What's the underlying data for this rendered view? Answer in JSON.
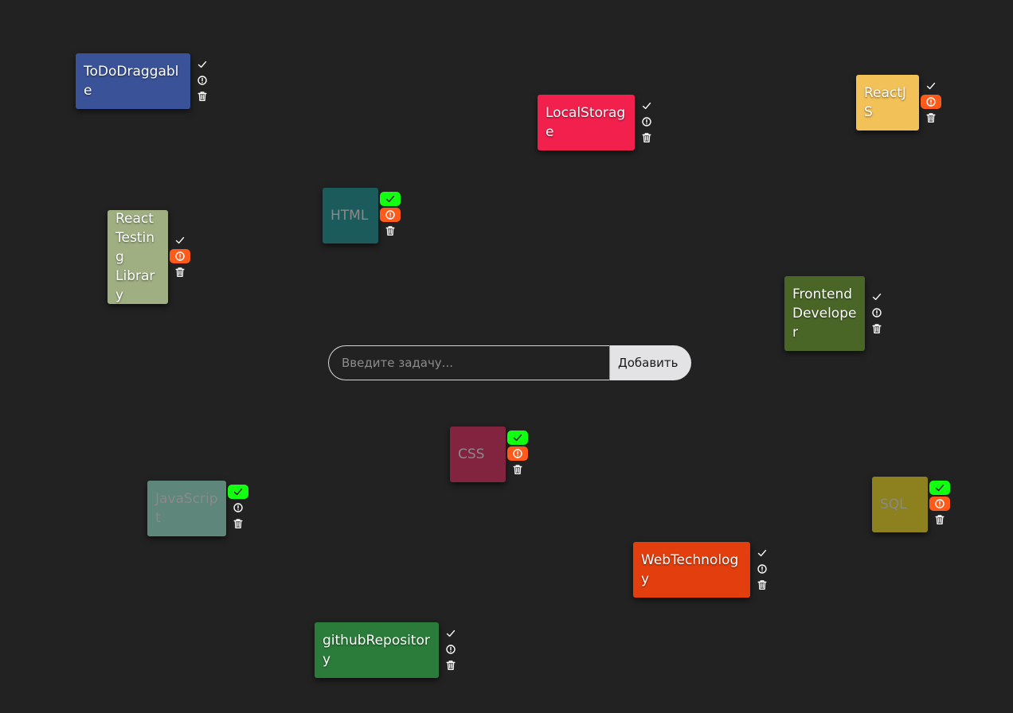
{
  "form": {
    "placeholder": "Введите задачу...",
    "value": "",
    "add_label": "Добавить"
  },
  "colors": {
    "background": "#222222",
    "done_active": "#12ff12",
    "important_active": "#ff5a1a"
  },
  "icons": {
    "done": "check-icon",
    "important": "alert-circle-icon",
    "delete": "trash-icon"
  },
  "tasks": [
    {
      "text": "ToDoDraggable",
      "color": "#3a5297",
      "done": false,
      "important": false
    },
    {
      "text": "LocalStorage",
      "color": "#f2204d",
      "done": false,
      "important": false
    },
    {
      "text": "ReactJS",
      "color": "#f2c158",
      "done": false,
      "important": true
    },
    {
      "text": "HTML",
      "color": "#1c5b5c",
      "done": true,
      "important": true
    },
    {
      "text": "React Testing Library",
      "color": "#9faf82",
      "done": false,
      "important": true
    },
    {
      "text": "Frontend Developer",
      "color": "#4a6627",
      "done": false,
      "important": false
    },
    {
      "text": "CSS",
      "color": "#82233f",
      "done": true,
      "important": true
    },
    {
      "text": "JavaScript",
      "color": "#5e867a",
      "done": true,
      "important": false
    },
    {
      "text": "SQL",
      "color": "#8c801f",
      "done": true,
      "important": true
    },
    {
      "text": "WebTechnology",
      "color": "#e33e0e",
      "done": false,
      "important": false
    },
    {
      "text": "githubRepository",
      "color": "#2b7c3a",
      "done": false,
      "important": false
    }
  ]
}
